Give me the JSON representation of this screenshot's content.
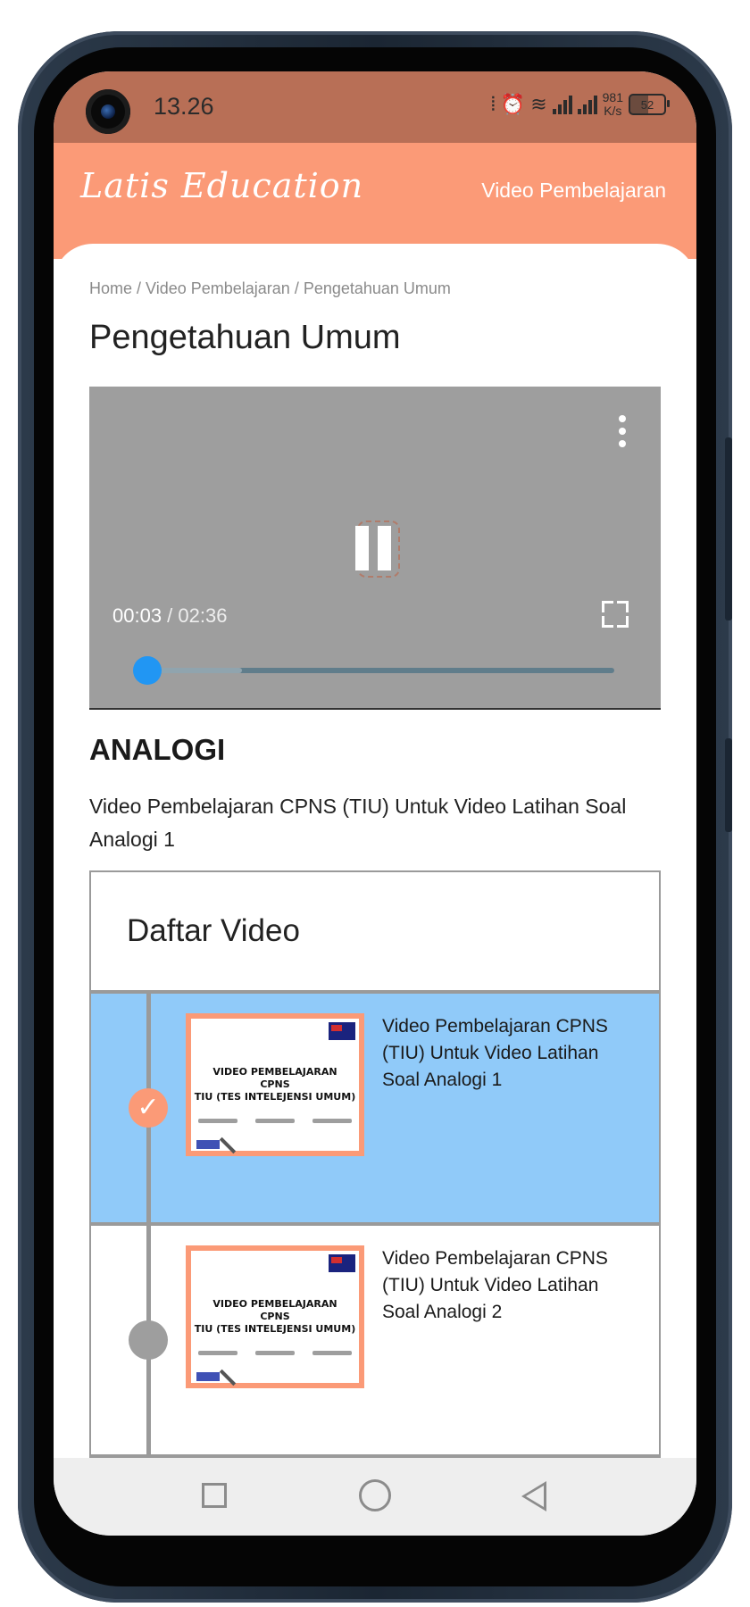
{
  "status_bar": {
    "time": "13.26",
    "net_speed_value": "981",
    "net_speed_unit": "K/s",
    "battery": "52"
  },
  "header": {
    "logo": "Latis Education",
    "nav_link": "Video Pembelajaran"
  },
  "breadcrumb": {
    "items": [
      "Home",
      "Video Pembelajaran",
      "Pengetahuan Umum"
    ],
    "separator": " / "
  },
  "page_title": "Pengetahuan Umum",
  "player": {
    "current_time": "00:03",
    "time_separator": " / ",
    "duration": "02:36",
    "progress": 0.02,
    "buffered": 0.22
  },
  "section": {
    "heading": "ANALOGI",
    "description": "Video Pembelajaran CPNS (TIU) Untuk Video Latihan Soal Analogi 1"
  },
  "video_list": {
    "title": "Daftar Video",
    "thumbnail_text": [
      "VIDEO PEMBELAJARAN",
      "CPNS",
      "TIU (TES INTELEJENSI UMUM)"
    ],
    "items": [
      {
        "title": "Video Pembelajaran CPNS (TIU) Untuk Video Latihan Soal Analogi 1",
        "status": "completed"
      },
      {
        "title": "Video Pembelajaran CPNS (TIU) Untuk Video Latihan Soal Analogi 2",
        "status": "pending"
      }
    ]
  },
  "colors": {
    "status_bar": "#b86f56",
    "brand": "#fb9a77",
    "active_item": "#90caf9",
    "player_thumb": "#2196f3"
  },
  "icons": {
    "menu": "more-vertical-icon",
    "pause": "pause-icon",
    "fullscreen": "fullscreen-icon",
    "check": "check-icon"
  }
}
